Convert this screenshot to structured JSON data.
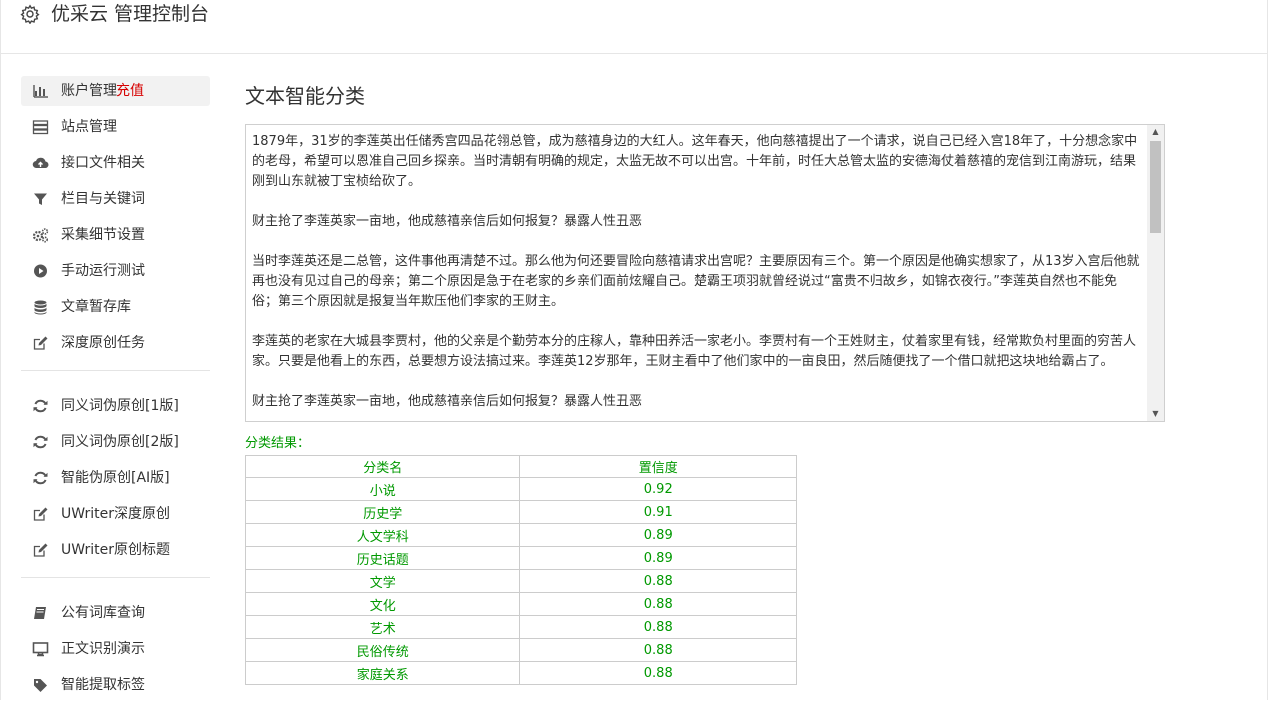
{
  "header": {
    "title": "优采云 管理控制台"
  },
  "sidebar": {
    "groups": [
      [
        {
          "label": "账户管理",
          "tag": "充值",
          "icon": "bar-chart-icon"
        },
        {
          "label": "站点管理",
          "icon": "server-icon"
        },
        {
          "label": "接口文件相关",
          "icon": "cloud-upload-icon"
        },
        {
          "label": "栏目与关键词",
          "icon": "filter-icon"
        },
        {
          "label": "采集细节设置",
          "icon": "gears-icon"
        },
        {
          "label": "手动运行测试",
          "icon": "play-circle-icon"
        },
        {
          "label": "文章暂存库",
          "icon": "database-icon"
        },
        {
          "label": "深度原创任务",
          "icon": "edit-icon"
        }
      ],
      [
        {
          "label": "同义词伪原创[1版]",
          "icon": "refresh-icon"
        },
        {
          "label": "同义词伪原创[2版]",
          "icon": "refresh-icon"
        },
        {
          "label": "智能伪原创[AI版]",
          "icon": "refresh-icon"
        },
        {
          "label": "UWriter深度原创",
          "icon": "edit-icon"
        },
        {
          "label": "UWriter原创标题",
          "icon": "edit-icon"
        }
      ],
      [
        {
          "label": "公有词库查询",
          "icon": "book-icon"
        },
        {
          "label": "正文识别演示",
          "icon": "desktop-icon"
        },
        {
          "label": "智能提取标签",
          "icon": "tag-icon"
        }
      ]
    ]
  },
  "main": {
    "title": "文本智能分类",
    "article_text": "1879年，31岁的李莲英出任储秀宫四品花翎总管，成为慈禧身边的大红人。这年春天，他向慈禧提出了一个请求，说自己已经入宫18年了，十分想念家中的老母，希望可以恩准自己回乡探亲。当时清朝有明确的规定，太监无故不可以出宫。十年前，时任大总管太监的安德海仗着慈禧的宠信到江南游玩，结果刚到山东就被丁宝桢给砍了。\n\n财主抢了李莲英家一亩地，他成慈禧亲信后如何报复？暴露人性丑恶\n\n当时李莲英还是二总管，这件事他再清楚不过。那么他为何还要冒险向慈禧请求出宫呢？主要原因有三个。第一个原因是他确实想家了，从13岁入宫后他就再也没有见过自己的母亲；第二个原因是急于在老家的乡亲们面前炫耀自己。楚霸王项羽就曾经说过“富贵不归故乡，如锦衣夜行。”李莲英自然也不能免俗；第三个原因就是报复当年欺压他们李家的王财主。\n\n李莲英的老家在大城县李贾村，他的父亲是个勤劳本分的庄稼人，靠种田养活一家老小。李贾村有一个王姓财主，仗着家里有钱，经常欺负村里面的穷苦人家。只要是他看上的东西，总要想方设法搞过来。李莲英12岁那年，王财主看中了他们家中的一亩良田，然后随便找了一个借口就把这块地给霸占了。\n\n财主抢了李莲英家一亩地，他成慈禧亲信后如何报复？暴露人性丑恶",
    "result_label": "分类结果：",
    "table": {
      "headers": [
        "分类名",
        "置信度"
      ],
      "rows": [
        [
          "小说",
          "0.92"
        ],
        [
          "历史学",
          "0.91"
        ],
        [
          "人文学科",
          "0.89"
        ],
        [
          "历史话题",
          "0.89"
        ],
        [
          "文学",
          "0.88"
        ],
        [
          "文化",
          "0.88"
        ],
        [
          "艺术",
          "0.88"
        ],
        [
          "民俗传统",
          "0.88"
        ],
        [
          "家庭关系",
          "0.88"
        ]
      ]
    }
  }
}
